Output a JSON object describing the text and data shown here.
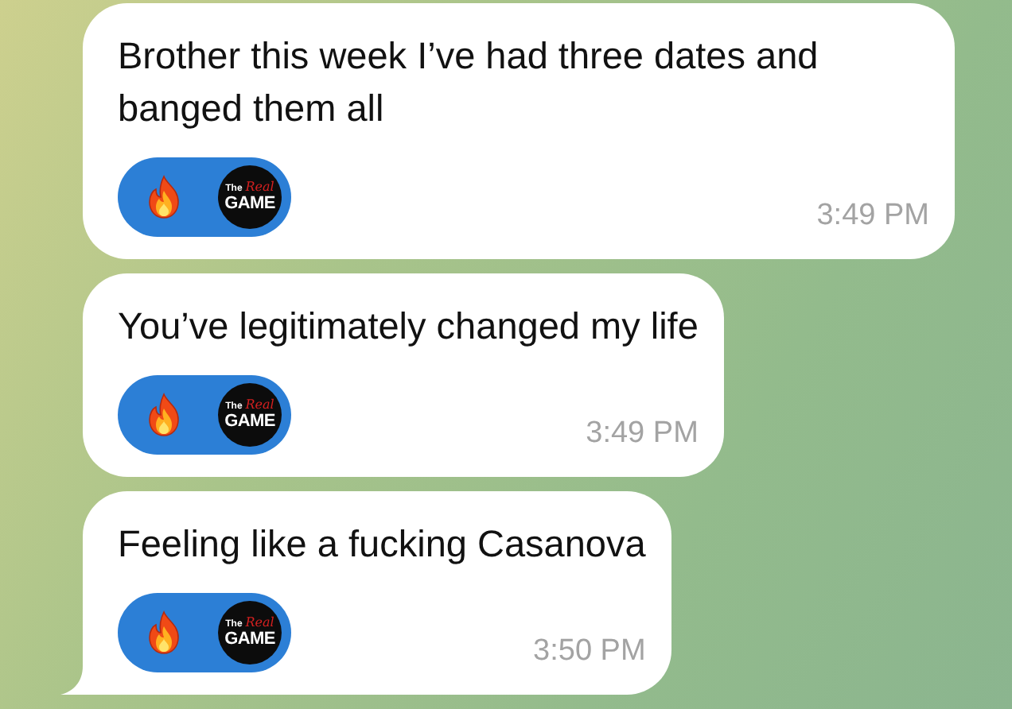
{
  "messages": [
    {
      "text": "Brother this week I’ve had three dates and banged them all",
      "time": "3:49 PM",
      "tail": false,
      "reaction": {
        "selected": true,
        "avatar": {
          "line_1": "The",
          "line_2": "Real",
          "line_3": "GAME"
        }
      }
    },
    {
      "text": "You’ve legitimately changed my life",
      "time": "3:49 PM",
      "tail": false,
      "reaction": {
        "selected": true,
        "avatar": {
          "line_1": "The",
          "line_2": "Real",
          "line_3": "GAME"
        }
      }
    },
    {
      "text": "Feeling like a fucking Casanova",
      "time": "3:50 PM",
      "tail": true,
      "reaction": {
        "selected": true,
        "avatar": {
          "line_1": "The",
          "line_2": "Real",
          "line_3": "GAME"
        }
      }
    }
  ]
}
